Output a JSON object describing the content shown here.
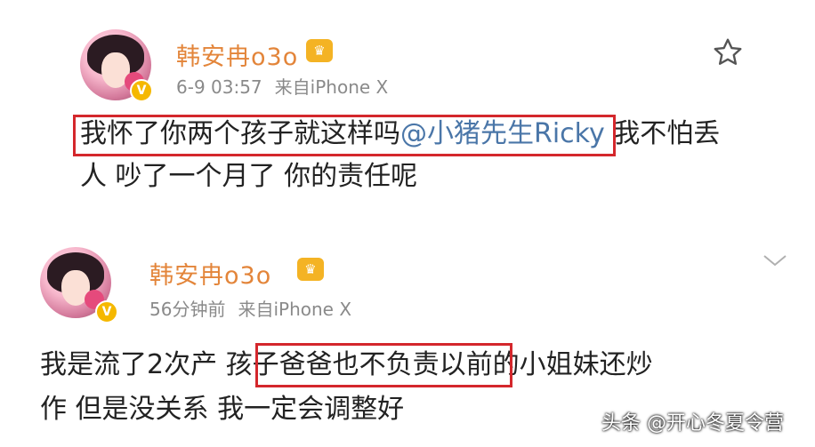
{
  "posts": [
    {
      "username": "韩安冉o3o",
      "time": "6-9 03:57",
      "source": "来自iPhone X",
      "content_before_mention": "我怀了你两个孩子就这样吗",
      "mention": "@小猪先生Ricky",
      "content_after_mention": " 我不怕丢",
      "content_line2": "人 吵了一个月了 你的责任呢"
    },
    {
      "username": "韩安冉o3o",
      "time": "56分钟前",
      "source": "来自iPhone X",
      "content_line1_a": "我是流了2次产 ",
      "content_line1_highlight": "孩子爸爸也不负责",
      "content_line1_b": "以前的小姐妹还炒",
      "content_line2": "作  但是没关系 我一定会调整好"
    }
  ],
  "watermark": "头条 @开心冬夏令营",
  "icons": {
    "verified": "v-badge-icon",
    "vip": "vip-crown-icon",
    "favorite": "star-icon",
    "more": "chevron-down-icon"
  },
  "colors": {
    "username": "#e3853a",
    "mention": "#4a76a8",
    "highlight_border": "#d4272c",
    "meta": "#8a8a8a"
  }
}
